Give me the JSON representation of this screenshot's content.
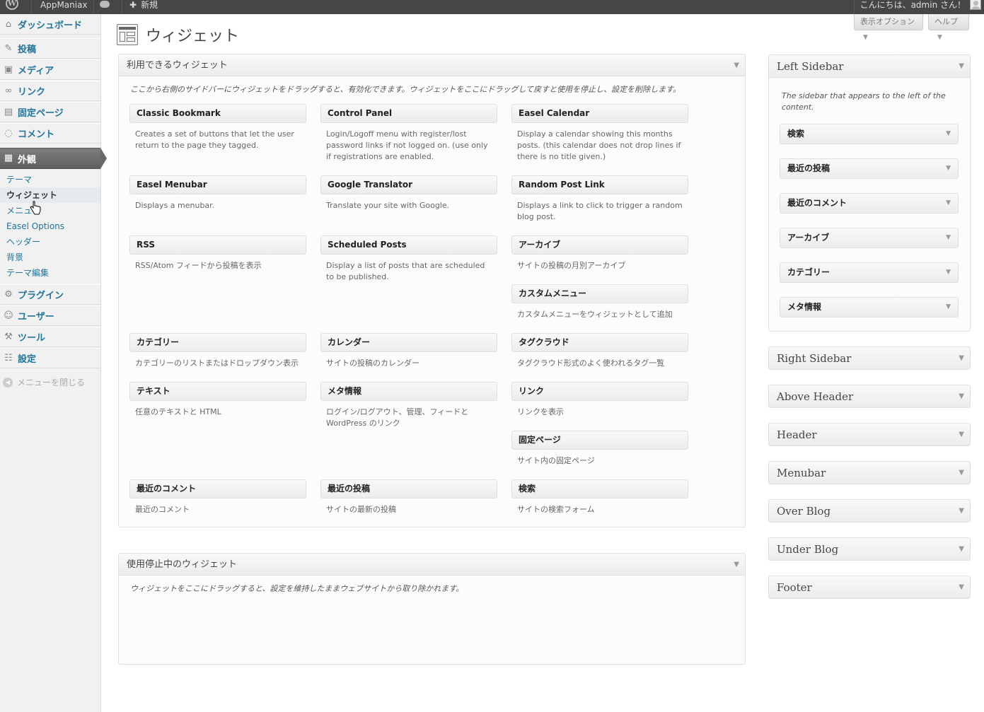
{
  "adminbar": {
    "site_name": "AppManiax",
    "new_label": "新規",
    "greeting": "こんにちは、admin さん！"
  },
  "screen_tabs": {
    "options": "表示オプション",
    "help": "ヘルプ"
  },
  "menu": {
    "dashboard": "ダッシュボード",
    "posts": "投稿",
    "media": "メディア",
    "links": "リンク",
    "pages": "固定ページ",
    "comments": "コメント",
    "appearance": "外観",
    "plugins": "プラグイン",
    "users": "ユーザー",
    "tools": "ツール",
    "settings": "設定",
    "collapse": "メニューを閉じる",
    "submenu": [
      "テーマ",
      "ウィジェット",
      "メニュー",
      "Easel Options",
      "ヘッダー",
      "背景",
      "テーマ編集"
    ]
  },
  "page_title": "ウィジェット",
  "available": {
    "title": "利用できるウィジェット",
    "description": "ここから右側のサイドバーにウィジェットをドラッグすると、有効化できます。ウィジェットをここにドラッグして戻すと使用を停止し、設定を削除します。",
    "widgets": [
      {
        "title": "Classic Bookmark",
        "desc": "Creates a set of buttons that let the user return to the page they tagged."
      },
      {
        "title": "Control Panel",
        "desc": "Login/Logoff menu with register/lost password links if not logged on. (use only if registrations are enabled."
      },
      {
        "title": "Easel Calendar",
        "desc": "Display a calendar showing this months posts. (this calendar does not drop lines if there is no title given.)"
      },
      {
        "title": "Easel Menubar",
        "desc": "Displays a menubar."
      },
      {
        "title": "Google Translator",
        "desc": "Translate your site with Google."
      },
      {
        "title": "Random Post Link",
        "desc": "Displays a link to click to trigger a random blog post."
      },
      {
        "title": "RSS",
        "desc": "RSS/Atom フィードから投稿を表示"
      },
      {
        "title": "Scheduled Posts",
        "desc": "Display a list of posts that are scheduled to be published."
      },
      {
        "title": "アーカイブ",
        "desc": "サイトの投稿の月別アーカイブ"
      },
      {
        "title": "カスタムメニュー",
        "desc": "カスタムメニューをウィジェットとして追加"
      },
      {
        "title": "カテゴリー",
        "desc": "カテゴリーのリストまたはドロップダウン表示"
      },
      {
        "title": "カレンダー",
        "desc": "サイトの投稿のカレンダー"
      },
      {
        "title": "タグクラウド",
        "desc": "タグクラウド形式のよく使われるタグ一覧"
      },
      {
        "title": "テキスト",
        "desc": "任意のテキストと HTML"
      },
      {
        "title": "メタ情報",
        "desc": "ログイン/ログアウト、管理、フィードと WordPress のリンク"
      },
      {
        "title": "リンク",
        "desc": "リンクを表示"
      },
      {
        "title": "固定ページ",
        "desc": "サイト内の固定ページ"
      },
      {
        "title": "最近のコメント",
        "desc": "最近のコメント"
      },
      {
        "title": "最近の投稿",
        "desc": "サイトの最新の投稿"
      },
      {
        "title": "検索",
        "desc": "サイトの検索フォーム"
      }
    ]
  },
  "inactive": {
    "title": "使用停止中のウィジェット",
    "description": "ウィジェットをここにドラッグすると、設定を維持したままウェブサイトから取り除かれます。"
  },
  "sidebars": {
    "left": {
      "title": "Left Sidebar",
      "description": "The sidebar that appears to the left of the content.",
      "widgets": [
        "検索",
        "最近の投稿",
        "最近のコメント",
        "アーカイブ",
        "カテゴリー",
        "メタ情報"
      ]
    },
    "others": [
      "Right Sidebar",
      "Above Header",
      "Header",
      "Menubar",
      "Over Blog",
      "Under Blog",
      "Footer"
    ]
  }
}
